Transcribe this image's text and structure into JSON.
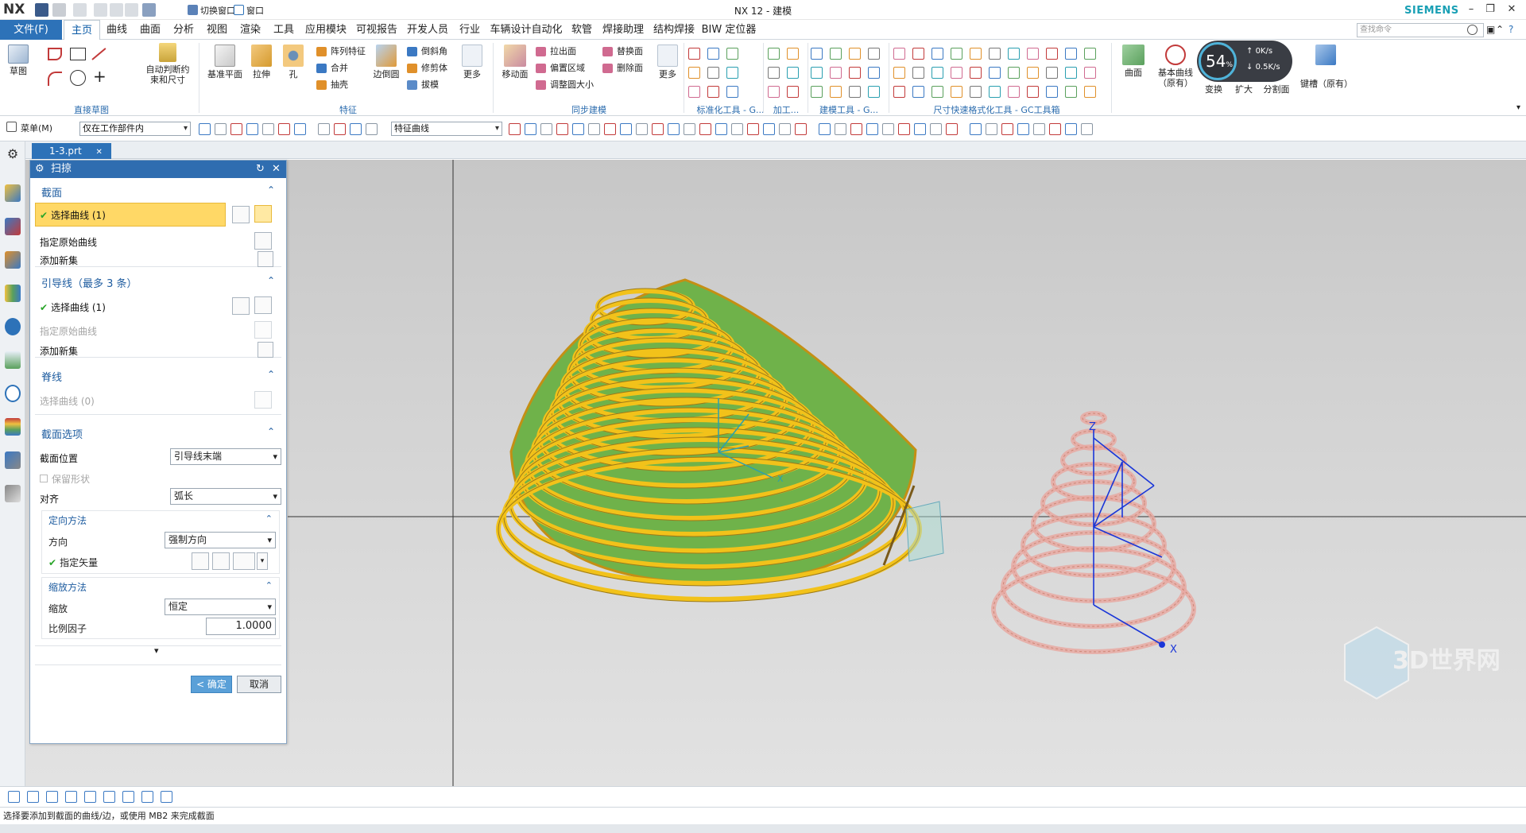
{
  "app": {
    "logo": "NX",
    "window_title": "NX 12 - 建模",
    "brand": "SIEMENS",
    "file_tab": "文件(F)",
    "switch_window": "切换窗口",
    "window_menu": "窗口",
    "search_placeholder": "查找命令"
  },
  "tabs": [
    "主页",
    "曲线",
    "曲面",
    "分析",
    "视图",
    "渲染",
    "工具",
    "应用模块",
    "可视报告",
    "开发人员",
    "行业",
    "车辆设计自动化",
    "软管",
    "焊接助理",
    "结构焊接",
    "BIW 定位器"
  ],
  "ribbon": {
    "sketch": "草图",
    "auto_constraint": [
      "自动判断约",
      "束和尺寸"
    ],
    "group_direct_sketch": "直接草图",
    "datum_plane": "基准平面",
    "extrude": "拉伸",
    "hole": "孔",
    "array_feature": "阵列特征",
    "unite": "合并",
    "shell": "抽壳",
    "edge_blend": "边倒圆",
    "chamfer": "倒斜角",
    "trim_body": "修剪体",
    "draft": "拔模",
    "more": "更多",
    "group_feature": "特征",
    "move_face": "移动面",
    "pull_face": "拉出面",
    "offset_region": "偏置区域",
    "resize_blend": "调整圆大小",
    "replace_face": "替换面",
    "delete_face": "删除面",
    "group_sync": "同步建模",
    "group_std_tools": "标准化工具 - G...",
    "group_machining": "加工...",
    "group_modeling_tools": "建模工具 - G...",
    "group_dim_tools": "尺寸快速格式化工具 - GC工具箱",
    "surface": "曲面",
    "basic_curve": [
      "基本曲线",
      "（原有）"
    ],
    "transform": "变换",
    "enlarge": "扩大",
    "divide_face": "分割面",
    "keyway": "键槽（原有）",
    "perf_percent": "54",
    "perf_percent_unit": "%",
    "perf_up": "0K/s",
    "perf_down": "0.5K/s"
  },
  "toolbar": {
    "menu": "菜单(M)",
    "filter_scope": "仅在工作部件内",
    "filter_type": "特征曲线"
  },
  "document_tab": "1-3.prt",
  "dialog": {
    "title": "扫掠",
    "section": {
      "header": "截面",
      "select_curve": "选择曲线 (1)",
      "specify_origin": "指定原始曲线",
      "add_new_set": "添加新集"
    },
    "guides": {
      "header": "引导线（最多 3 条）",
      "select_curve": "选择曲线 (1)",
      "specify_origin": "指定原始曲线",
      "add_new_set": "添加新集"
    },
    "spine": {
      "header": "脊线",
      "select_curve": "选择曲线 (0)"
    },
    "section_options": {
      "header": "截面选项",
      "position_label": "截面位置",
      "position_value": "引导线末端",
      "preserve_shape": "保留形状",
      "alignment_label": "对齐",
      "alignment_value": "弧长"
    },
    "orientation": {
      "header": "定向方法",
      "direction_label": "方向",
      "direction_value": "强制方向",
      "specify_vector": "指定矢量"
    },
    "scaling": {
      "header": "缩放方法",
      "scale_label": "缩放",
      "scale_value": "恒定",
      "factor_label": "比例因子",
      "factor_value": "1.0000"
    },
    "ok": "< 确定 >",
    "cancel": "取消"
  },
  "axes": {
    "x": "X",
    "z": "Z"
  },
  "status": "选择要添加到截面的曲线/边，或使用 MB2 来完成截面",
  "watermark": "3D世界网",
  "colors": {
    "accent": "#2d72b8",
    "selection": "#ffd866",
    "model_yellow": "#f2c21a",
    "model_green": "#6fb24a",
    "preview_pink": "#e8a9a2"
  }
}
